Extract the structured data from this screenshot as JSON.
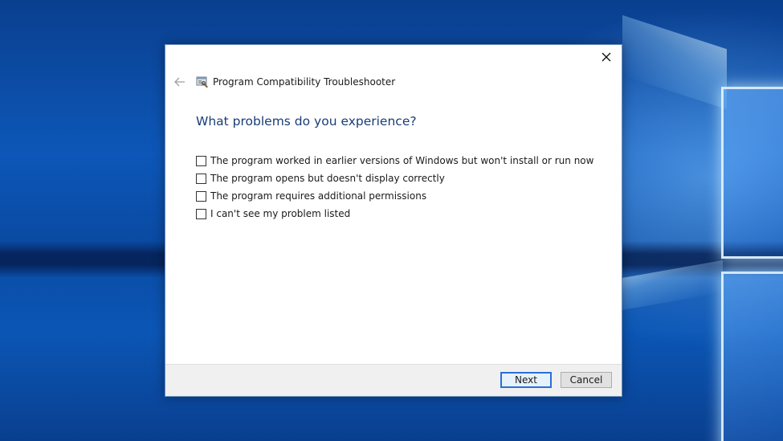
{
  "window": {
    "title": "Program Compatibility Troubleshooter"
  },
  "page": {
    "question": "What problems do you experience?"
  },
  "options": [
    {
      "label": "The program worked in earlier versions of Windows but won't install or run now",
      "checked": false
    },
    {
      "label": "The program opens but doesn't display correctly",
      "checked": false
    },
    {
      "label": "The program requires additional permissions",
      "checked": false
    },
    {
      "label": "I can't see my problem listed",
      "checked": false
    }
  ],
  "buttons": {
    "next": "Next",
    "cancel": "Cancel"
  },
  "icons": {
    "close": "close-icon",
    "back": "back-arrow-icon",
    "app": "troubleshooter-icon"
  },
  "colors": {
    "heading": "#1a3c78",
    "focus_border": "#2a6fd6",
    "desktop": "#0d57b8"
  }
}
